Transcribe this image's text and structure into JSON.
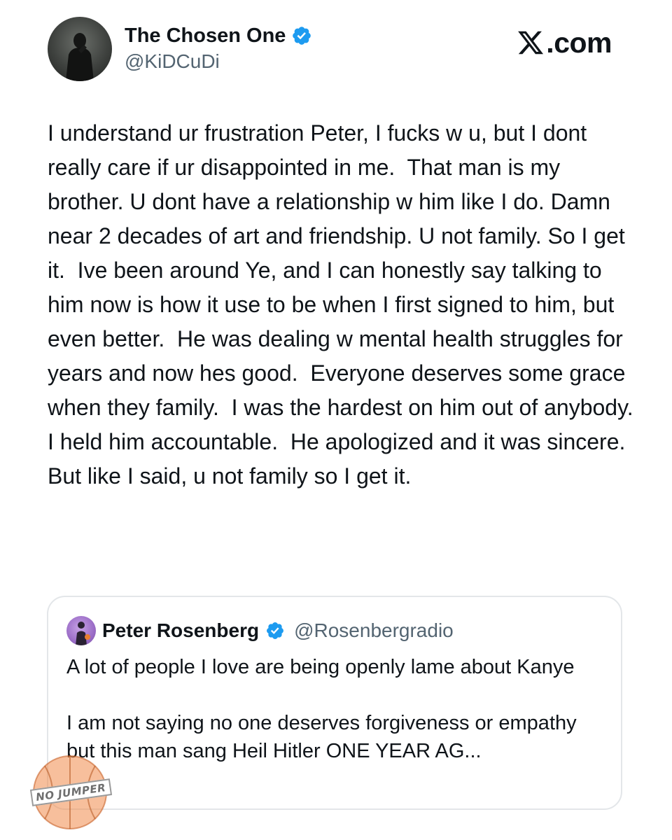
{
  "author": {
    "display_name": "The Chosen One",
    "handle": "@KiDCuDi",
    "verified_icon": "verified-badge-icon",
    "badge_color": "#1d9bf0"
  },
  "site": {
    "label": ".com",
    "logo_icon": "x-logo-icon"
  },
  "tweet": {
    "text": "I understand ur frustration Peter, I fucks w u, but I dont really care if ur disappointed in me.  That man is my brother. U dont have a relationship w him like I do. Damn near 2 decades of art and friendship. U not family. So I get it.  Ive been around Ye, and I can honestly say talking to him now is how it use to be when I first signed to him, but even better.  He was dealing w mental health struggles for years and now hes good.  Everyone deserves some grace when they family.  I was the hardest on him out of anybody. I held him accountable.  He apologized and it was sincere. But like I said, u not family so I get it."
  },
  "quoted_tweet": {
    "display_name": "Peter Rosenberg",
    "handle": "@Rosenbergradio",
    "verified_icon": "verified-badge-icon",
    "text": "A lot of people I love are being openly lame about Kanye\n\nI am not saying no one deserves forgiveness or empathy but this man sang Heil Hitler ONE YEAR AG..."
  },
  "watermark": {
    "text": "NO JUMPER"
  }
}
